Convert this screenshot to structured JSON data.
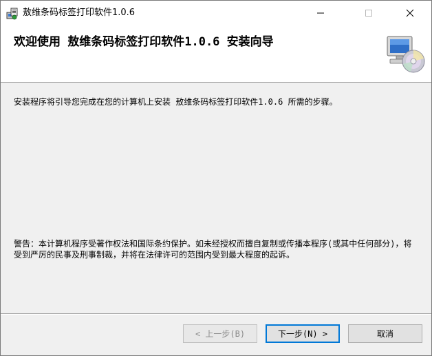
{
  "window": {
    "title": "敖维条码标签打印软件1.0.6",
    "controls": {
      "minimize_icon": "minimize-icon",
      "maximize_icon": "maximize-icon",
      "close_icon": "close-icon"
    }
  },
  "banner": {
    "title": "欢迎使用 敖维条码标签打印软件1.0.6 安装向导",
    "icon": "computer-disc-icon"
  },
  "body": {
    "intro": "安装程序将引导您完成在您的计算机上安装 敖维条码标签打印软件1.0.6 所需的步骤。",
    "warning": "警告：本计算机程序受著作权法和国际条约保护。如未经授权而擅自复制或传播本程序(或其中任何部分)，将受到严厉的民事及刑事制裁，并将在法律许可的范围内受到最大程度的起诉。"
  },
  "buttons": {
    "back": "< 上一步(B)",
    "next": "下一步(N) >",
    "cancel": "取消"
  },
  "colors": {
    "accent": "#0078d7",
    "dialog_bg": "#f0f0f0",
    "banner_bg": "#ffffff"
  }
}
